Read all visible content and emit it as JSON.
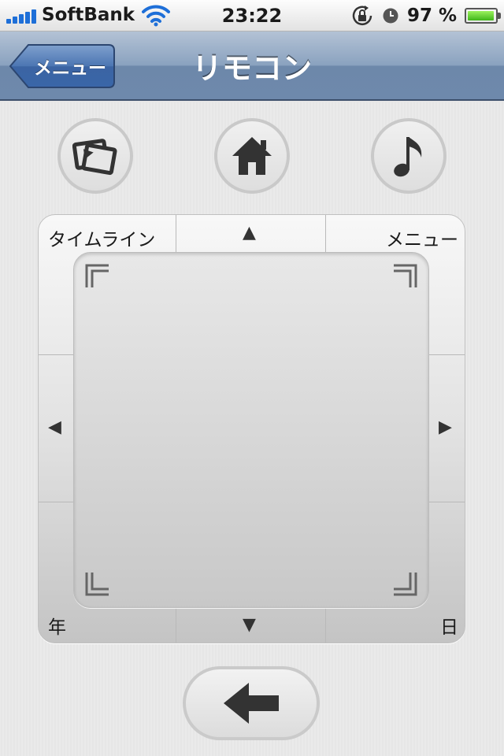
{
  "status": {
    "carrier": "SoftBank",
    "time": "23:22",
    "battery_text": "97 %",
    "battery_level": 0.97,
    "icons": [
      "signal-icon",
      "wifi-icon",
      "rotation-lock-icon",
      "alarm-icon",
      "battery-icon"
    ]
  },
  "nav": {
    "back_label": "メニュー",
    "title": "リモコン"
  },
  "toolbar": {
    "icons": [
      "photo-slideshow-icon",
      "home-icon",
      "music-note-icon"
    ]
  },
  "pad": {
    "top_left": "タイムライン",
    "top_right": "メニュー",
    "bottom_left": "年",
    "bottom_right": "日",
    "up": "▲",
    "down": "▼",
    "left": "◀",
    "right": "▶"
  },
  "bottom": {
    "icon": "back-arrow-icon"
  },
  "colors": {
    "navbar": "#7b93b4",
    "back_button": "#3b68a8",
    "wifi": "#1e6fd8",
    "battery": "#5cd431"
  }
}
